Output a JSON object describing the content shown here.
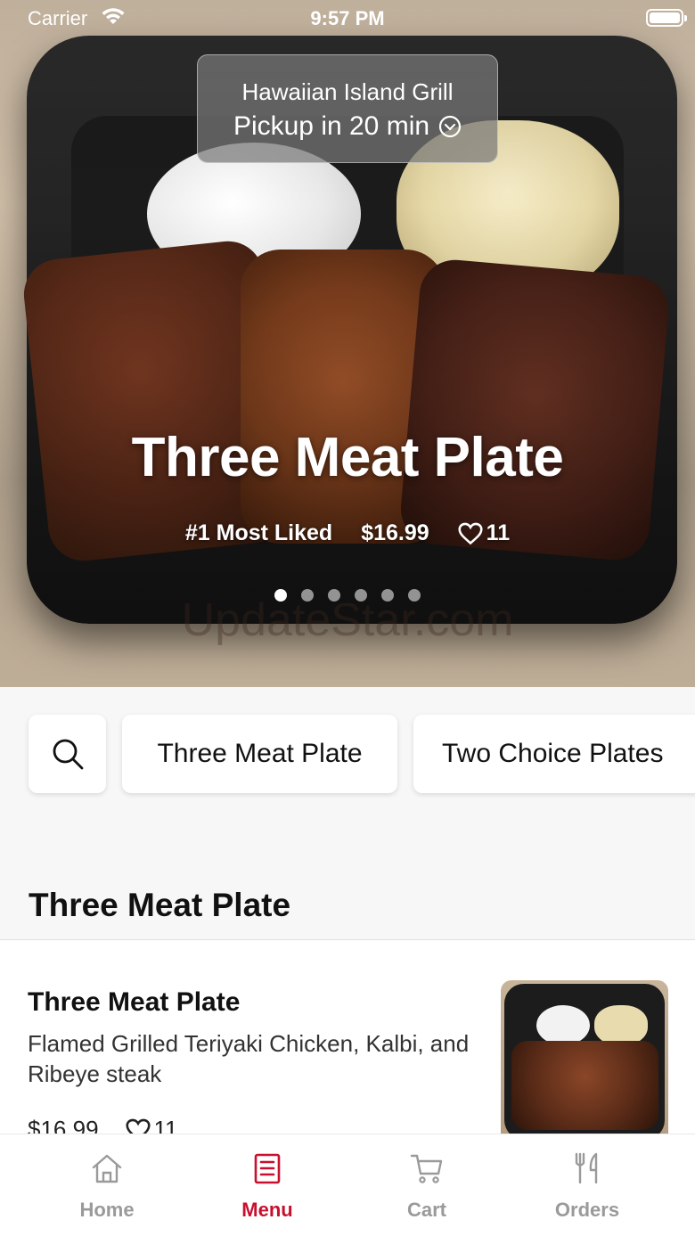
{
  "status_bar": {
    "carrier": "Carrier",
    "time": "9:57 PM"
  },
  "store": {
    "name": "Hawaiian Island Grill",
    "pickup": "Pickup in 20 min"
  },
  "hero": {
    "title": "Three Meat Plate",
    "badge": "#1 Most Liked",
    "price": "$16.99",
    "likes": "11",
    "slide_count": 6,
    "active_slide": 1
  },
  "watermark": "UpdateStar.com",
  "categories": {
    "search_icon": "search-icon",
    "items": [
      "Three Meat Plate",
      "Two Choice Plates"
    ]
  },
  "section": {
    "title": "Three Meat Plate"
  },
  "menu_items": [
    {
      "name": "Three Meat Plate",
      "description": "Flamed Grilled Teriyaki Chicken, Kalbi, and Ribeye steak",
      "price": "$16.99",
      "likes": "11"
    }
  ],
  "tab_bar": {
    "tabs": [
      {
        "label": "Home",
        "icon": "home-icon",
        "active": false
      },
      {
        "label": "Menu",
        "icon": "menu-list-icon",
        "active": true
      },
      {
        "label": "Cart",
        "icon": "cart-icon",
        "active": false
      },
      {
        "label": "Orders",
        "icon": "utensils-icon",
        "active": false
      }
    ]
  },
  "colors": {
    "accent": "#c8102e",
    "inactive": "#9a9a9a",
    "background": "#f7f7f7"
  }
}
